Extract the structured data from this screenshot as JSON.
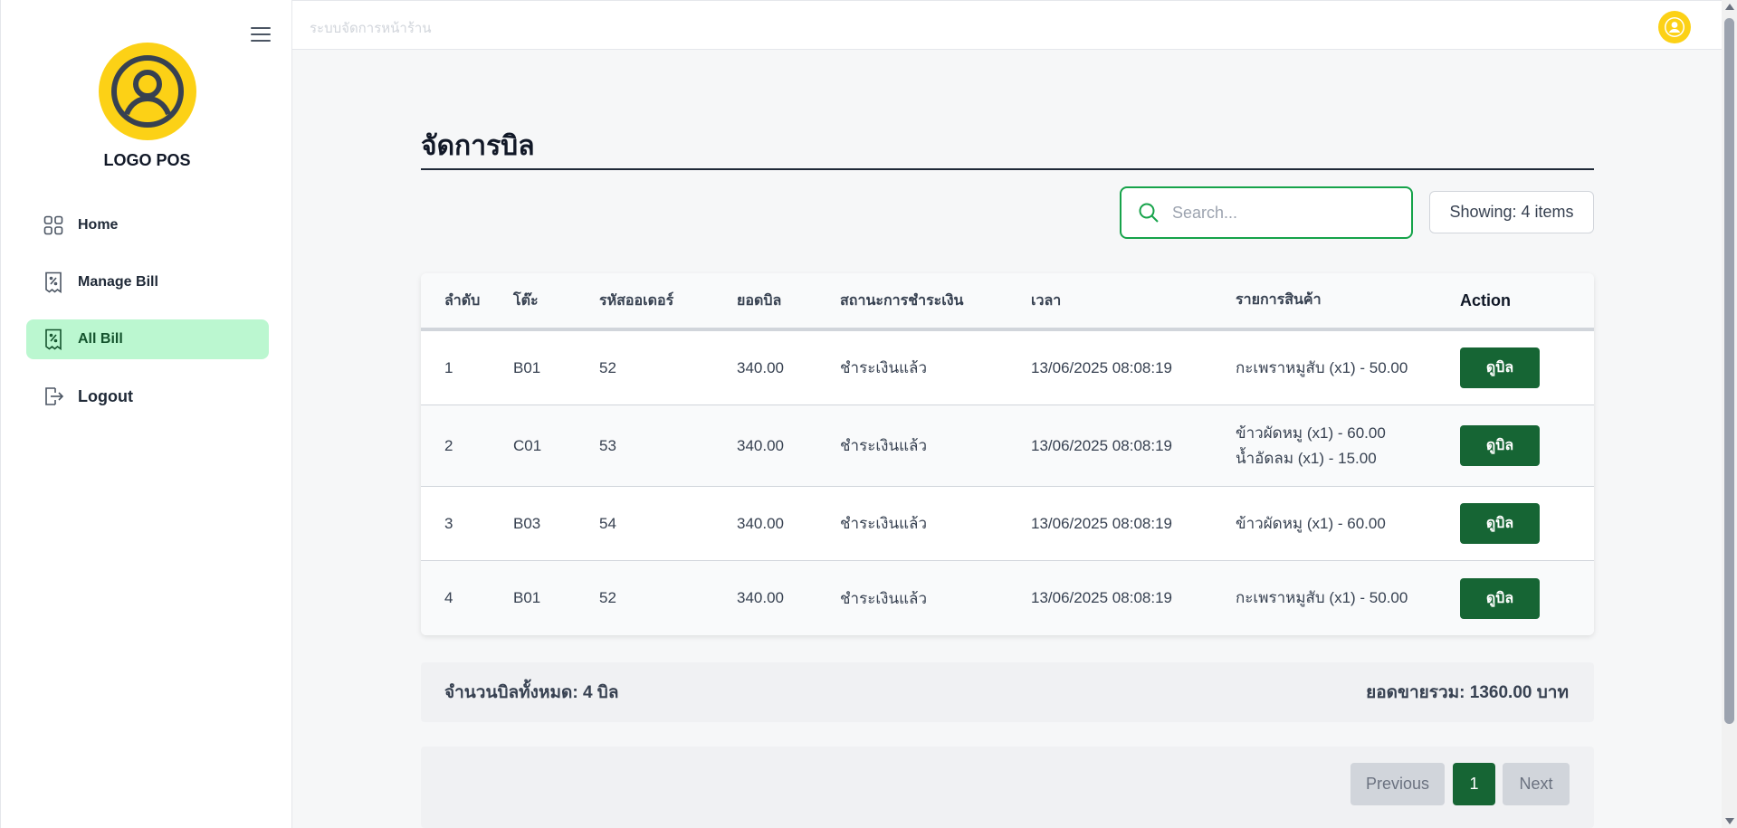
{
  "header": {
    "title": "ระบบจัดการหน้าร้าน"
  },
  "sidebar": {
    "logo_text": "LOGO POS",
    "items": [
      {
        "label": "Home",
        "icon": "grid-icon"
      },
      {
        "label": "Manage Bill",
        "icon": "receipt-icon"
      },
      {
        "label": "All Bill",
        "icon": "receipt-icon",
        "active": true
      },
      {
        "label": "Logout",
        "icon": "logout-icon"
      }
    ]
  },
  "main": {
    "page_title": "จัดการบิล",
    "search": {
      "placeholder": "Search...",
      "value": ""
    },
    "showing": "Showing: 4 items",
    "table": {
      "headers": [
        "ลำดับ",
        "โต๊ะ",
        "รหัสออเดอร์",
        "ยอดบิล",
        "สถานะการชำระเงิน",
        "เวลา",
        "รายการสินค้า",
        "Action"
      ],
      "rows": [
        {
          "no": "1",
          "table": "B01",
          "order_id": "52",
          "total": "340.00",
          "status": "ชำระเงินแล้ว",
          "time": "13/06/2025 08:08:19",
          "items": [
            "กะเพราหมูสับ (x1) - 50.00"
          ],
          "action": "ดูบิล"
        },
        {
          "no": "2",
          "table": "C01",
          "order_id": "53",
          "total": "340.00",
          "status": "ชำระเงินแล้ว",
          "time": "13/06/2025 08:08:19",
          "items": [
            "ข้าวผัดหมู (x1) - 60.00",
            "น้ำอัดลม (x1) - 15.00"
          ],
          "action": "ดูบิล"
        },
        {
          "no": "3",
          "table": "B03",
          "order_id": "54",
          "total": "340.00",
          "status": "ชำระเงินแล้ว",
          "time": "13/06/2025 08:08:19",
          "items": [
            "ข้าวผัดหมู (x1) - 60.00"
          ],
          "action": "ดูบิล"
        },
        {
          "no": "4",
          "table": "B01",
          "order_id": "52",
          "total": "340.00",
          "status": "ชำระเงินแล้ว",
          "time": "13/06/2025 08:08:19",
          "items": [
            "กะเพราหมูสับ (x1) - 50.00"
          ],
          "action": "ดูบิล"
        }
      ]
    },
    "summary": {
      "count_text": "จำนวนบิลทั้งหมด: 4 บิล",
      "total_text": "ยอดขายรวม: 1360.00 บาท"
    },
    "pagination": {
      "previous": "Previous",
      "current": "1",
      "next": "Next"
    }
  },
  "colors": {
    "accent_green": "#166534",
    "active_nav_bg": "#bbf7d0",
    "logo_yellow": "#fcd116",
    "search_border": "#16a34a"
  }
}
